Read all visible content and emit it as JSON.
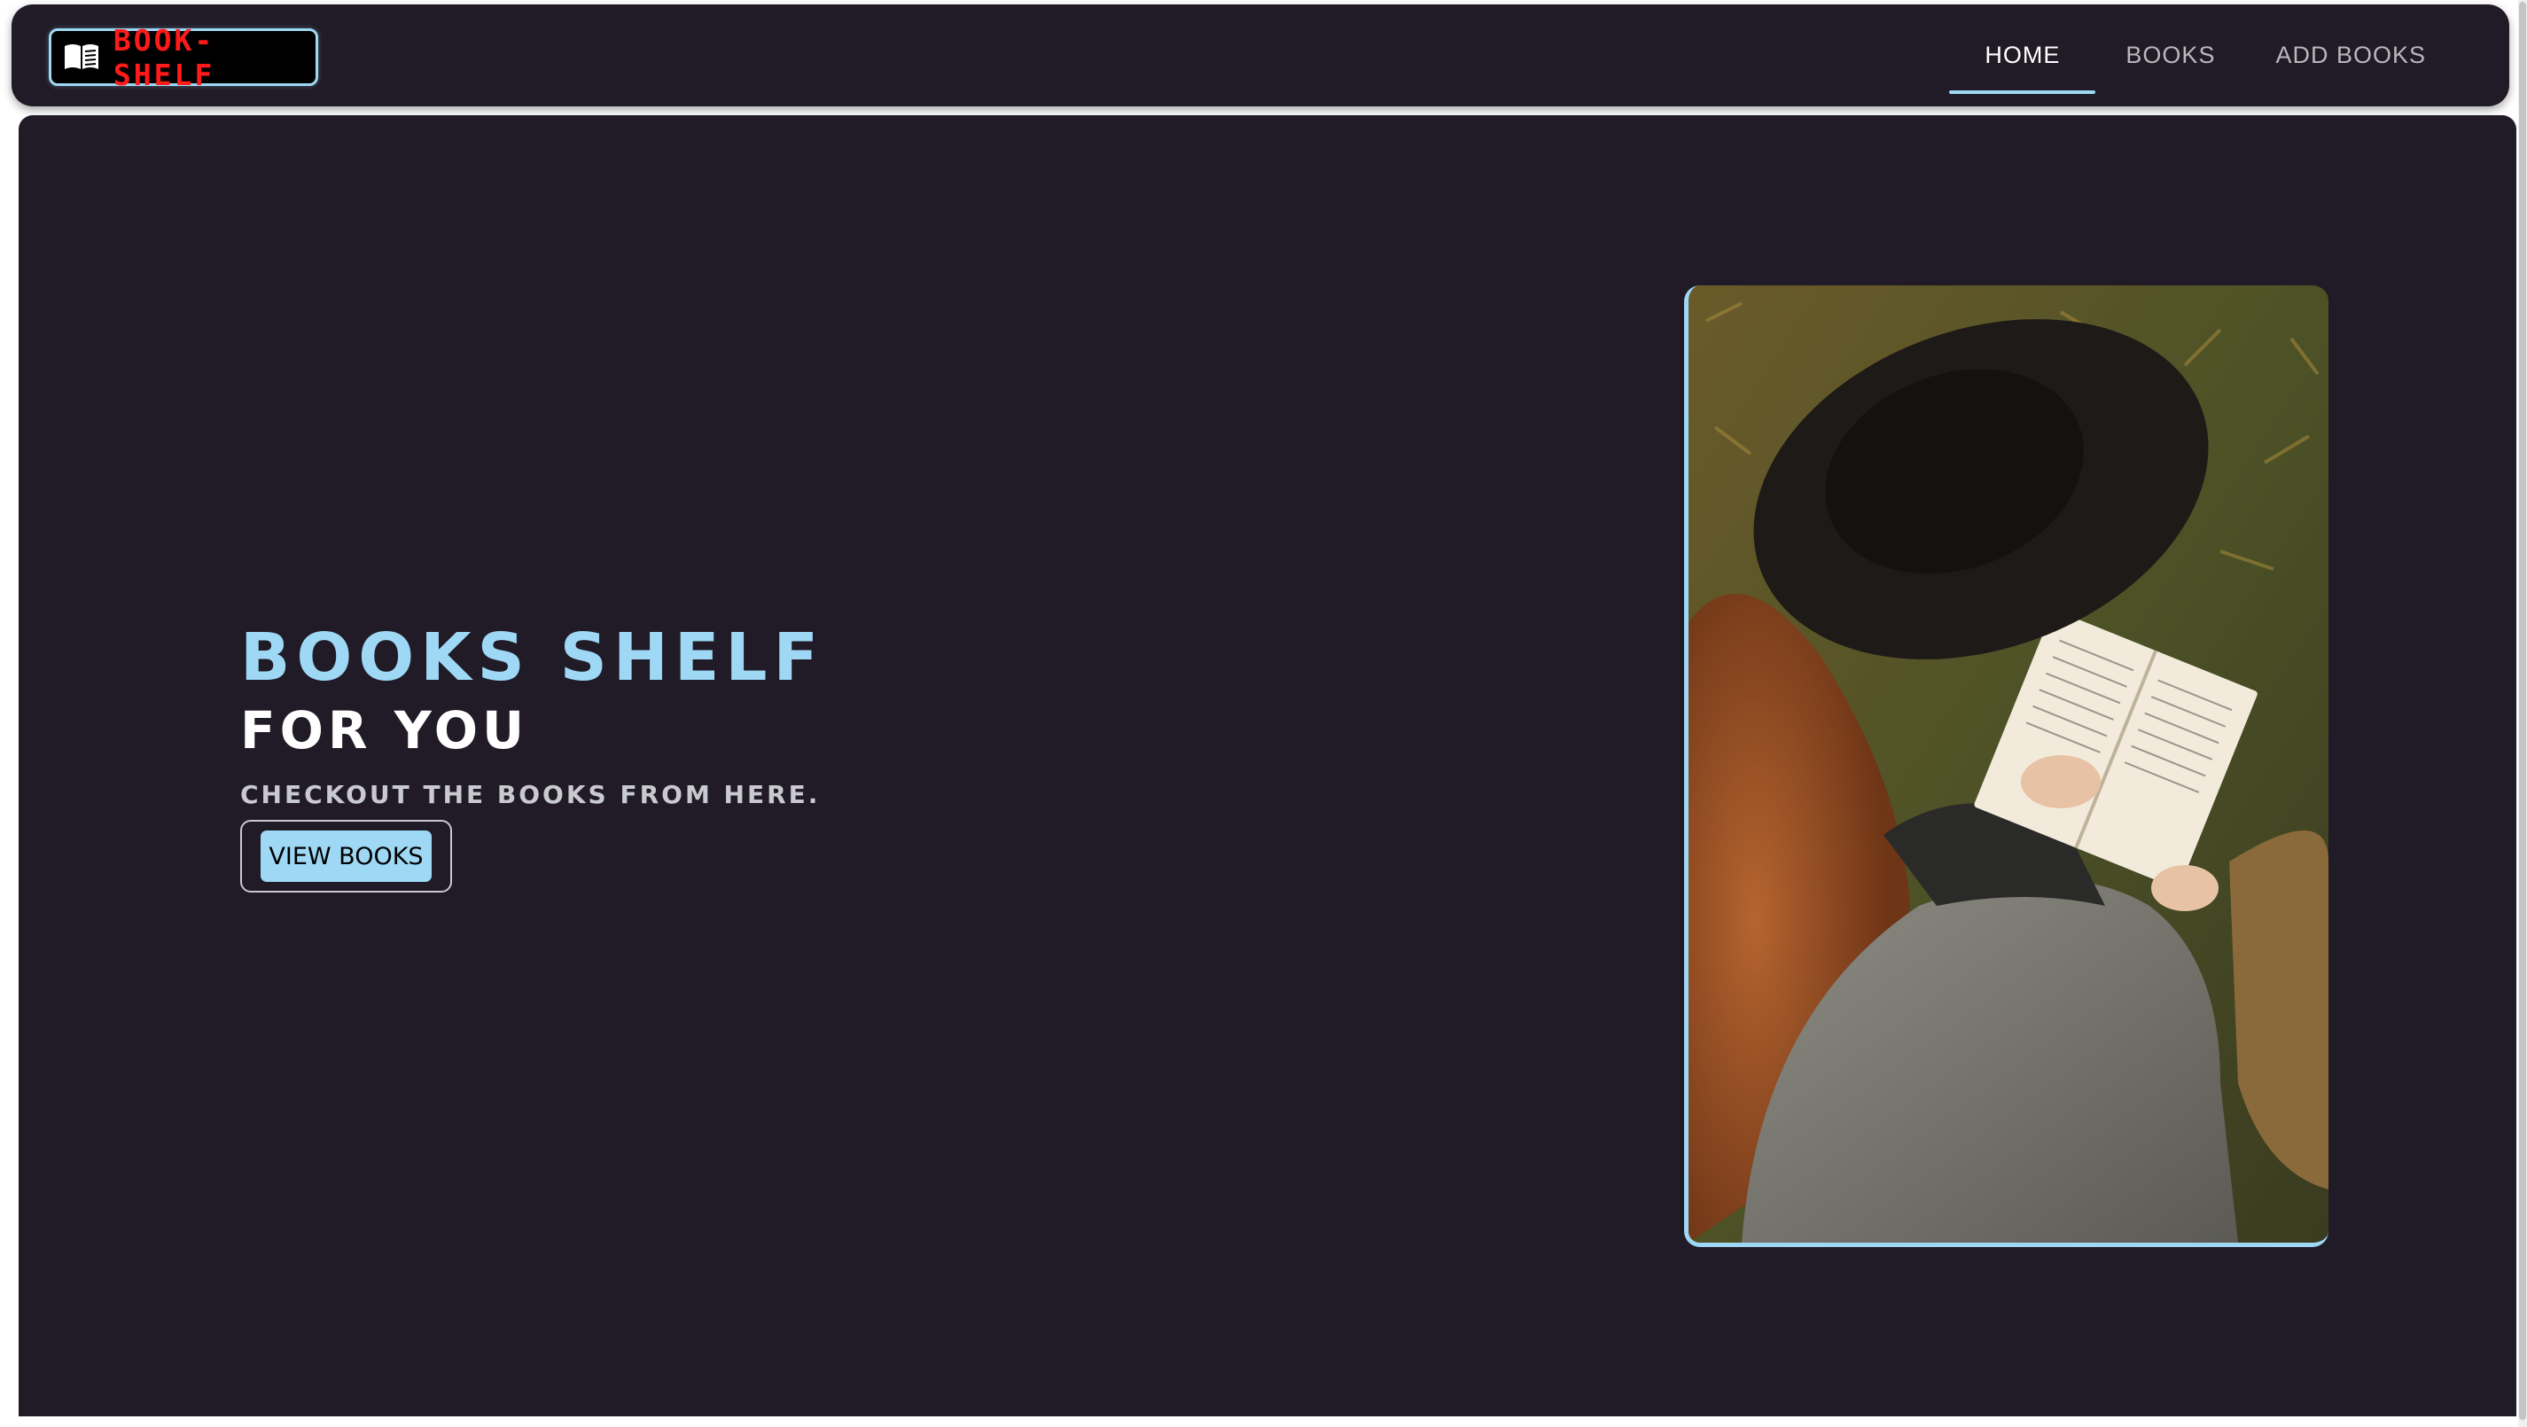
{
  "brand": {
    "name": "BOOK-SHELF",
    "icon": "open-book-icon",
    "text_color": "#ff1a1a"
  },
  "nav": {
    "items": [
      {
        "label": "HOME",
        "active": true
      },
      {
        "label": "BOOKS",
        "active": false
      },
      {
        "label": "ADD BOOKS",
        "active": false
      }
    ]
  },
  "hero": {
    "title": "BOOKS SHELF",
    "subtitle": "FOR YOU",
    "tagline": "CHECKOUT THE BOOKS FROM HERE.",
    "cta_label": "VIEW BOOKS",
    "image": "woman-reading-book-photo"
  },
  "colors": {
    "background": "#201b26",
    "accent": "#9ed8f5",
    "brand_red": "#ff1a1a"
  }
}
